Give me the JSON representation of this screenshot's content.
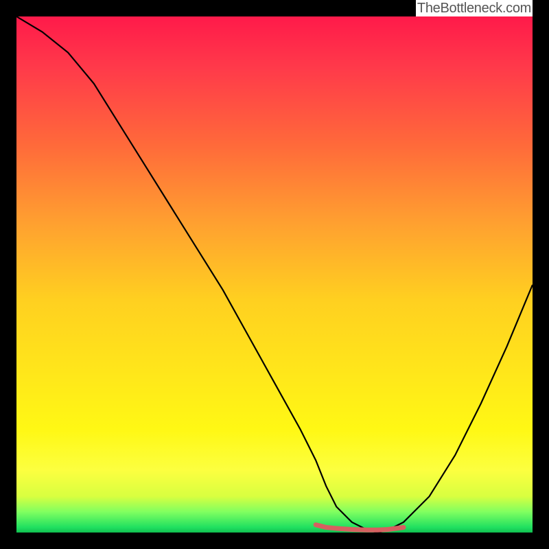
{
  "attribution": "TheBottleneck.com",
  "colors": {
    "frame": "#000000",
    "curve": "#000000",
    "marker": "#d66060",
    "gradient_top": "#ff1a4a",
    "gradient_bottom": "#10c050"
  },
  "chart_data": {
    "type": "line",
    "title": "",
    "xlabel": "",
    "ylabel": "",
    "xlim": [
      0,
      100
    ],
    "ylim": [
      0,
      100
    ],
    "series": [
      {
        "name": "curve",
        "x": [
          0,
          5,
          10,
          15,
          20,
          25,
          30,
          35,
          40,
          45,
          50,
          55,
          58,
          60,
          62,
          65,
          68,
          70,
          72,
          75,
          80,
          85,
          90,
          95,
          100
        ],
        "y": [
          100,
          97,
          93,
          87,
          79,
          71,
          63,
          55,
          47,
          38,
          29,
          20,
          14,
          9,
          5,
          2,
          0.5,
          0,
          0.5,
          2,
          7,
          15,
          25,
          36,
          48
        ]
      },
      {
        "name": "bottom-highlight",
        "x": [
          58,
          60,
          62,
          65,
          68,
          70,
          72,
          75
        ],
        "y": [
          1.5,
          1.0,
          0.8,
          0.6,
          0.5,
          0.5,
          0.6,
          1.0
        ]
      }
    ],
    "annotations": []
  }
}
